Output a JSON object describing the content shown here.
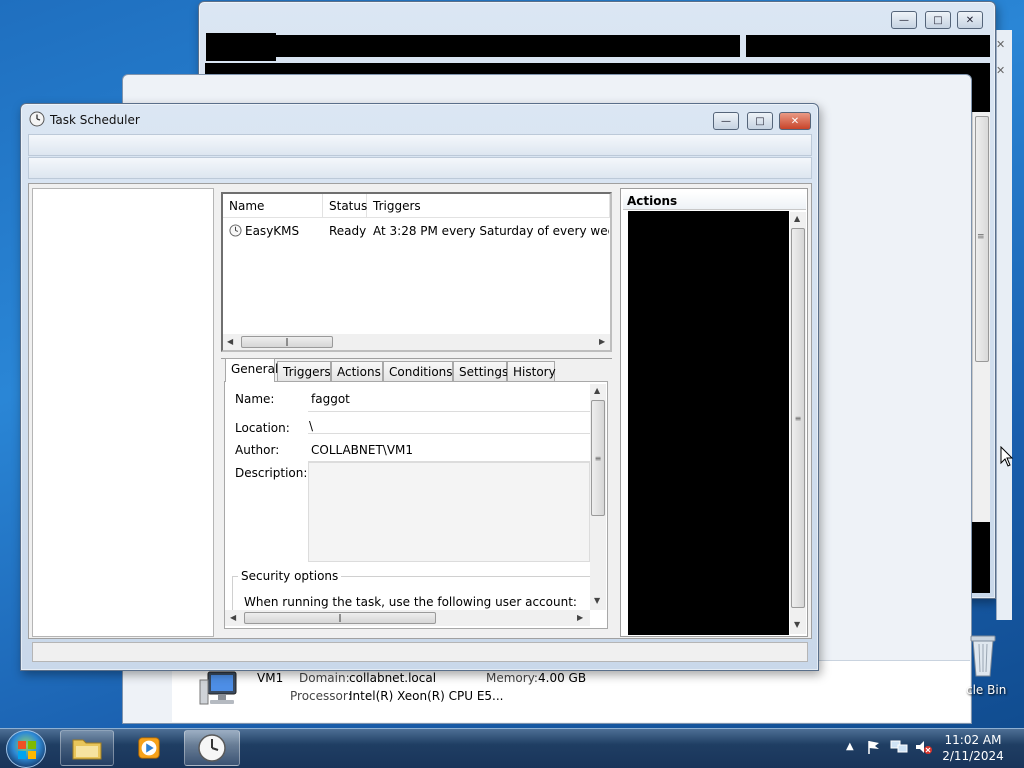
{
  "task_scheduler": {
    "title": "Task Scheduler",
    "task_list": {
      "columns": [
        "Name",
        "Status",
        "Triggers"
      ],
      "rows": [
        {
          "name": "EasyKMS",
          "status": "Ready",
          "triggers": "At 3:28 PM every Saturday of every week, star"
        }
      ]
    },
    "tabs": [
      "General",
      "Triggers",
      "Actions",
      "Conditions",
      "Settings",
      "History"
    ],
    "general": {
      "name_label": "Name:",
      "name_value": "faggot",
      "location_label": "Location:",
      "location_value": "\\",
      "author_label": "Author:",
      "author_value": "COLLABNET\\VM1",
      "description_label": "Description:",
      "security_options_title": "Security options",
      "security_text": "When running the task, use the following user account:"
    },
    "actions_header": "Actions"
  },
  "system_info": {
    "computer_name": "VM1",
    "domain_label": "Domain:",
    "domain_value": "collabnet.local",
    "memory_label": "Memory:",
    "memory_value": "4.00 GB",
    "processor_label": "Processor:",
    "processor_value": "Intel(R) Xeon(R) CPU E5..."
  },
  "desktop": {
    "recycle_bin_label": "cle Bin"
  },
  "taskbar": {
    "time": "11:02 AM",
    "date": "2/11/2024"
  },
  "icons": {
    "clock": "clock-icon",
    "explorer": "folder-icon",
    "media_player": "media-player-icon",
    "task_scheduler": "task-scheduler-icon",
    "tray_arrow": "tray-arrow-icon",
    "flag": "action-center-flag-icon",
    "network": "network-icon",
    "volume_muted": "volume-muted-icon"
  }
}
